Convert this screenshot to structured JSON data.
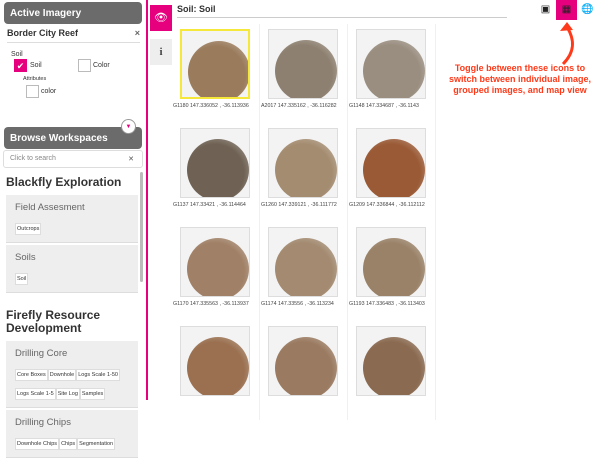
{
  "sidebar": {
    "active_imagery": "Active Imagery",
    "workspace": "Border City Reef",
    "close": "×",
    "layer_group": "Soil",
    "checkboxes": [
      {
        "label": "Soil",
        "checked": true
      },
      {
        "label": "Color",
        "checked": false
      }
    ],
    "attributes_label": "Attributes",
    "attribute": {
      "label": "color",
      "checked": false
    },
    "browse": "Browse Workspaces",
    "search_placeholder": "Click to search",
    "projects": [
      {
        "name": "Blackfly Exploration",
        "cards": [
          {
            "title": "Field Assesment",
            "tags": [
              "Outcrops"
            ]
          },
          {
            "title": "Soils",
            "tags": [
              "Soil"
            ]
          }
        ]
      },
      {
        "name": "Firefly Resource Development",
        "cards": [
          {
            "title": "Drilling Core",
            "tags": [
              "Core Boxes",
              "Downhole",
              "Logs Scale 1-50",
              "Logs Scale 1-5",
              "Site Log",
              "Samples"
            ]
          },
          {
            "title": "Drilling Chips",
            "tags": [
              "Downhole Chips",
              "Chips",
              "Segmentation"
            ]
          }
        ]
      }
    ]
  },
  "header": {
    "title": "Soil: Soil"
  },
  "views": [
    {
      "icon": "image-icon",
      "active": false
    },
    {
      "icon": "grid-icon",
      "active": true
    },
    {
      "icon": "globe-icon",
      "active": false
    }
  ],
  "annotation": "Toggle between these icons to switch between individual image, grouped images, and map view",
  "accent": "#e6007e",
  "images": [
    [
      {
        "caption": "G1180 147.336052 , -36.113936",
        "color": "#9a7b5c",
        "selected": true
      },
      {
        "caption": "A2017 147.335162 , -36.116282",
        "color": "#8d8070"
      },
      {
        "caption": "G1148 147.334687 , -36.1143",
        "color": "#9a8e80"
      }
    ],
    [
      {
        "caption": "G1137 147.33421 , -36.114464",
        "color": "#6f6254"
      },
      {
        "caption": "G1260 147.339121 , -36.111772",
        "color": "#a48c70"
      },
      {
        "caption": "G1209 147.336844 , -36.112112",
        "color": "#9a5a35"
      }
    ],
    [
      {
        "caption": "G1170 147.335563 , -36.113937",
        "color": "#a08066"
      },
      {
        "caption": "G1174 147.33556 , -36.113234",
        "color": "#a38a70"
      },
      {
        "caption": "G1193 147.336483 , -36.113403",
        "color": "#9a8268"
      }
    ],
    [
      {
        "caption": "",
        "color": "#9a7050"
      },
      {
        "caption": "",
        "color": "#9a7a60"
      },
      {
        "caption": "",
        "color": "#8a6a50"
      }
    ]
  ]
}
